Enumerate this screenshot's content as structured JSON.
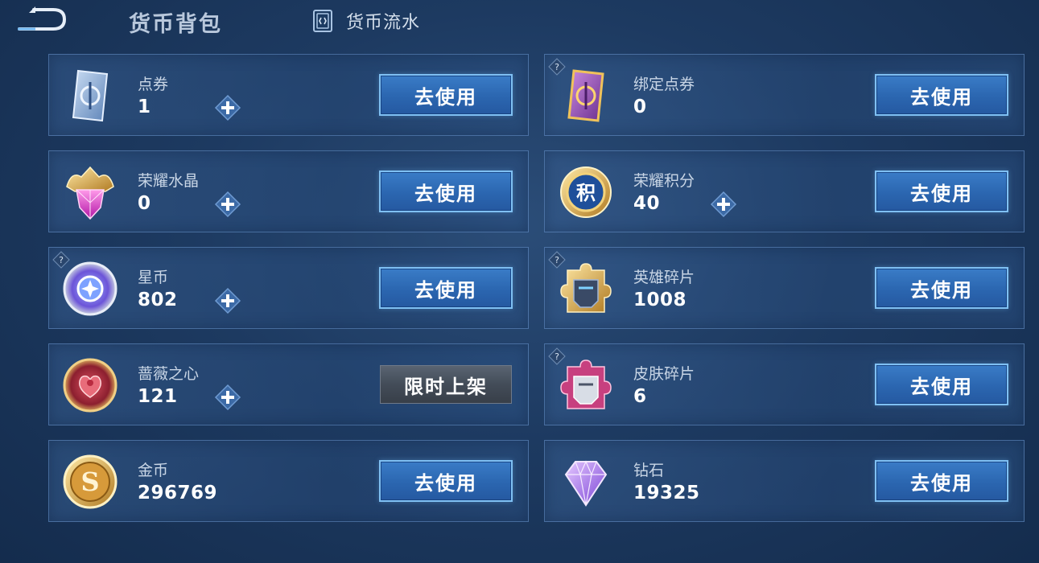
{
  "header": {
    "title": "货币背包",
    "flow_label": "货币流水"
  },
  "currencies": [
    {
      "name": "点券",
      "amount": "1",
      "button": "去使用",
      "has_plus": true,
      "has_help": false,
      "icon": "coupon-card-icon"
    },
    {
      "name": "绑定点券",
      "amount": "0",
      "button": "去使用",
      "has_plus": false,
      "has_help": true,
      "icon": "bound-coupon-card-icon"
    },
    {
      "name": "荣耀水晶",
      "amount": "0",
      "button": "去使用",
      "has_plus": true,
      "has_help": false,
      "icon": "glory-crystal-icon"
    },
    {
      "name": "荣耀积分",
      "amount": "40",
      "button": "去使用",
      "has_plus": true,
      "has_help": false,
      "icon": "glory-points-icon"
    },
    {
      "name": "星币",
      "amount": "802",
      "button": "去使用",
      "has_plus": true,
      "has_help": true,
      "icon": "star-coin-icon"
    },
    {
      "name": "英雄碎片",
      "amount": "1008",
      "button": "去使用",
      "has_plus": false,
      "has_help": true,
      "icon": "hero-fragment-icon"
    },
    {
      "name": "蔷薇之心",
      "amount": "121",
      "button": "限时上架",
      "has_plus": true,
      "has_help": false,
      "icon": "rose-heart-icon"
    },
    {
      "name": "皮肤碎片",
      "amount": "6",
      "button": "去使用",
      "has_plus": false,
      "has_help": true,
      "icon": "skin-fragment-icon"
    },
    {
      "name": "金币",
      "amount": "296769",
      "button": "去使用",
      "has_plus": false,
      "has_help": false,
      "icon": "gold-coin-icon"
    },
    {
      "name": "钻石",
      "amount": "19325",
      "button": "去使用",
      "has_plus": false,
      "has_help": false,
      "icon": "diamond-icon"
    }
  ],
  "colors": {
    "background": "#1d3a61",
    "button_blue": "#2b66b0",
    "button_border": "#7fc0f3",
    "limited_gray": "#434c58"
  }
}
